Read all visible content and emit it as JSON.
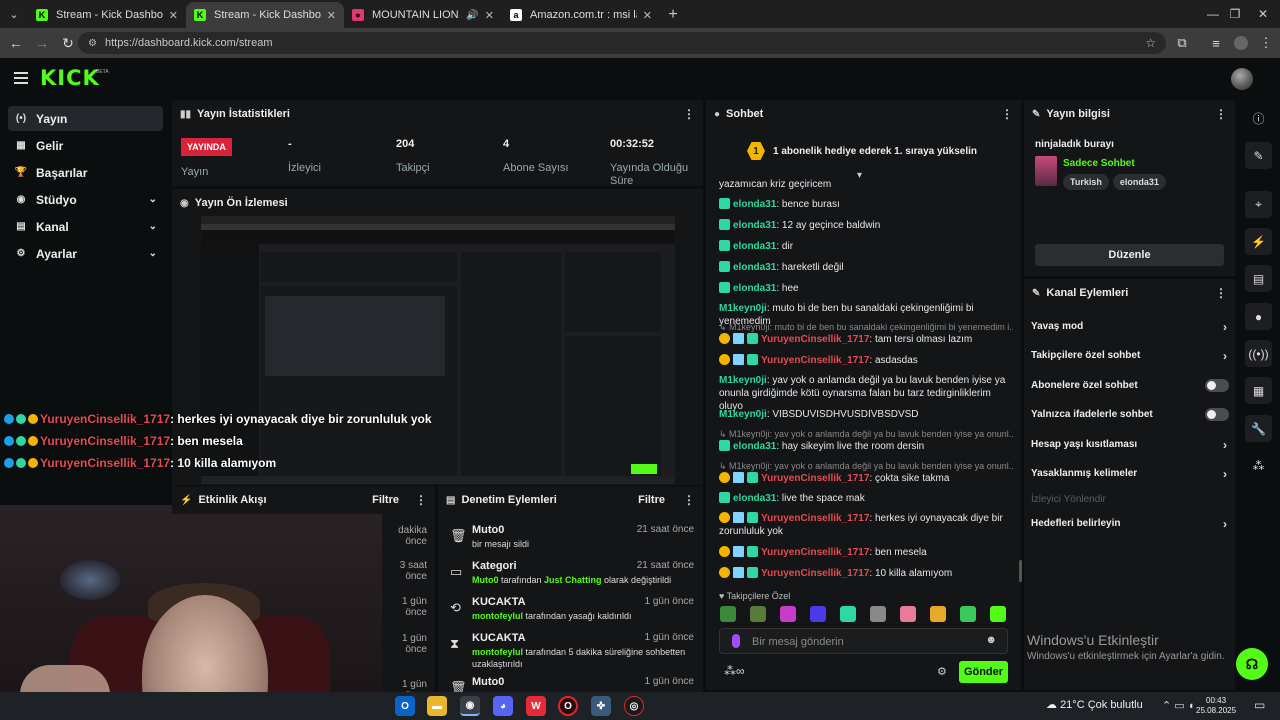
{
  "browser": {
    "tabs": [
      {
        "title": "Stream - Kick Dashboard",
        "favicon": "K",
        "color": "#53fc18",
        "active": false
      },
      {
        "title": "Stream - Kick Dashboard",
        "favicon": "K",
        "color": "#53fc18",
        "active": true
      },
      {
        "title": "MOUNTAIN LION // ADORE",
        "favicon": "●",
        "color": "#e8356d",
        "active": false
      },
      {
        "title": "Amazon.com.tr : msi laptop",
        "favicon": "a",
        "color": "#ffffff",
        "active": false
      }
    ],
    "url": "https://dashboard.kick.com/stream"
  },
  "header": {
    "logo": "KICK",
    "beta": "BETA"
  },
  "sidebar": {
    "items": [
      {
        "label": "Yayın",
        "icon": "broadcast-icon",
        "glyph": "(•)",
        "active": true,
        "chevron": false
      },
      {
        "label": "Gelir",
        "icon": "revenue-icon",
        "glyph": "▦",
        "active": false,
        "chevron": false
      },
      {
        "label": "Başarılar",
        "icon": "trophy-icon",
        "glyph": "🏆",
        "active": false,
        "chevron": false
      },
      {
        "label": "Stüdyo",
        "icon": "studio-icon",
        "glyph": "◉",
        "active": false,
        "chevron": true
      },
      {
        "label": "Kanal",
        "icon": "channel-icon",
        "glyph": "▤",
        "active": false,
        "chevron": true
      },
      {
        "label": "Ayarlar",
        "icon": "settings-icon",
        "glyph": "⚙",
        "active": false,
        "chevron": true
      }
    ]
  },
  "stats": {
    "title": "Yayın İstatistikleri",
    "live_badge": "YAYINDA",
    "live_label": "Yayın",
    "items": [
      {
        "value": "-",
        "label": "İzleyici"
      },
      {
        "value": "204",
        "label": "Takipçi"
      },
      {
        "value": "4",
        "label": "Abone Sayısı"
      },
      {
        "value": "00:32:52",
        "label": "Yayında Olduğu Süre"
      }
    ]
  },
  "preview": {
    "title": "Yayın Ön İzlemesi"
  },
  "overlay_chat": [
    {
      "user": "YuruyenCinsellik_1717",
      "text": ": herkes iyi oynayacak diye bir zorunluluk yok"
    },
    {
      "user": "YuruyenCinsellik_1717",
      "text": ": ben mesela"
    },
    {
      "user": "YuruyenCinsellik_1717",
      "text": ": 10 killa alamıyom"
    }
  ],
  "activity": {
    "title": "Etkinlik Akışı",
    "filter": "Filtre",
    "rows": [
      "dakika önce",
      "3 saat önce",
      "1 gün önce",
      "1 gün önce",
      "1 gün önce"
    ]
  },
  "moderation": {
    "title": "Denetim Eylemleri",
    "filter": "Filtre",
    "rows": [
      {
        "who": "Muto0",
        "when": "21 saat önce",
        "icon": "trash-icon",
        "glyph": "🗑",
        "pre": "",
        "hl1": "",
        "mid": "bir mesajı sildi",
        "hl2": "",
        "post": ""
      },
      {
        "who": "Kategori",
        "when": "21 saat önce",
        "icon": "category-icon",
        "glyph": "▭",
        "pre": "",
        "hl1": "Muto0",
        "mid": " tarafından ",
        "hl2": "Just Chatting",
        "post": " olarak değiştirildi"
      },
      {
        "who": "KUCAKTA",
        "when": "1 gün önce",
        "icon": "unban-icon",
        "glyph": "⟲",
        "pre": "",
        "hl1": "montofeylul",
        "mid": " tarafından yasağı kaldırıldı",
        "hl2": "",
        "post": ""
      },
      {
        "who": "KUCAKTA",
        "when": "1 gün önce",
        "icon": "hourglass-icon",
        "glyph": "⧗",
        "pre": "",
        "hl1": "montofeylul",
        "mid": " tarafından 5 dakika süreliğine sohbetten uzaklaştırıldı",
        "hl2": "",
        "post": ""
      },
      {
        "who": "Muto0",
        "when": "1 gün önce",
        "icon": "trash-icon",
        "glyph": "🗑",
        "pre": "",
        "hl1": "",
        "mid": "",
        "hl2": "",
        "post": ""
      }
    ]
  },
  "chat": {
    "title": "Sohbet",
    "gift_count": "1",
    "gift_text": "1 abonelik hediye ederek 1. sıraya yükseliN",
    "gift_text_display": "1 abonelik hediye ederek 1. sıraya yükselin",
    "messages": [
      {
        "kind": "plain",
        "text": "yazamıcan kriz geçiricem"
      },
      {
        "kind": "teal",
        "user": "elonda31",
        "text": ": bence burası"
      },
      {
        "kind": "teal",
        "user": "elonda31",
        "text": ": 12 ay geçince baldwin"
      },
      {
        "kind": "teal",
        "user": "elonda31",
        "text": ": dir"
      },
      {
        "kind": "teal",
        "user": "elonda31",
        "text": ": hareketli değil"
      },
      {
        "kind": "teal",
        "user": "elonda31",
        "text": ": hee"
      },
      {
        "kind": "mk",
        "user": "M1keyn0ji",
        "text": ": muto bi de ben bu sanaldaki çekingenliğimi bi yenemedim"
      },
      {
        "kind": "reply",
        "text": "↳ M1keyn0ji: muto bi de ben bu sanaldaki çekingenliğimi bi yenemedim i..."
      },
      {
        "kind": "red",
        "user": "YuruyenCinsellik_1717",
        "text": ": tam tersi olması lazım"
      },
      {
        "kind": "red",
        "user": "YuruyenCinsellik_1717",
        "text": ": asdasdas"
      },
      {
        "kind": "mk",
        "user": "M1keyn0ji",
        "text": ": yav yok o anlamda değil ya bu lavuk benden iyise ya onunla girdiğimde kötü oynarsma falan bu tarz tedirginliklerim oluyo"
      },
      {
        "kind": "mk",
        "user": "M1keyn0ji",
        "text": ": VIBSDUVISDHVUSDIVBSDVSD"
      },
      {
        "kind": "reply",
        "text": "↳ M1keyn0ji: yav yok o anlamda değil ya bu lavuk benden iyise ya onunl..."
      },
      {
        "kind": "teal",
        "user": "elonda31",
        "text": ": hay sikeyim live the room dersin"
      },
      {
        "kind": "reply",
        "text": "↳ M1keyn0ji: yav yok o anlamda değil ya bu lavuk benden iyise ya onunl..."
      },
      {
        "kind": "red",
        "user": "YuruyenCinsellik_1717",
        "text": ": çokta sike takma"
      },
      {
        "kind": "teal",
        "user": "elonda31",
        "text": ": live the space mak"
      },
      {
        "kind": "red",
        "user": "YuruyenCinsellik_1717",
        "text": ": herkes iyi oynayacak diye bir zorunluluk yok"
      },
      {
        "kind": "red",
        "user": "YuruyenCinsellik_1717",
        "text": ": ben mesela"
      },
      {
        "kind": "red",
        "user": "YuruyenCinsellik_1717",
        "text": ": 10 killa alamıyom"
      }
    ],
    "followers_only": "♥ Takipçilere Özel",
    "input_placeholder": "Bir mesaj gönderin",
    "send": "Gönder"
  },
  "stream_info": {
    "title": "Yayın bilgisi",
    "stream_title": "ninjaladık burayı",
    "category": "Sadece Sohbet",
    "tags": [
      "Turkish",
      "elonda31"
    ],
    "edit": "Düzenle"
  },
  "channel_actions": {
    "title": "Kanal Eylemleri",
    "items": [
      {
        "label": "Yavaş mod",
        "type": "chevron"
      },
      {
        "label": "Takipçilere özel sohbet",
        "type": "chevron"
      },
      {
        "label": "Abonelere özel sohbet",
        "type": "toggle"
      },
      {
        "label": "Yalnızca ifadelerle sohbet",
        "type": "toggle"
      },
      {
        "label": "Hesap yaşı kısıtlaması",
        "type": "chevron"
      },
      {
        "label": "Yasaklanmış kelimeler",
        "type": "chevron"
      }
    ],
    "disabled_item": "İzleyici Yönlendir",
    "last_item": "Hedefleri belirleyin"
  },
  "windows_watermark": {
    "title": "Windows'u Etkinleştir",
    "subtitle": "Windows'u etkinleştirmek için Ayarlar'a gidin."
  },
  "taskbar": {
    "weather": "21°C  Çok bulutlu",
    "time": "00:43",
    "date": "25.08.2025"
  }
}
